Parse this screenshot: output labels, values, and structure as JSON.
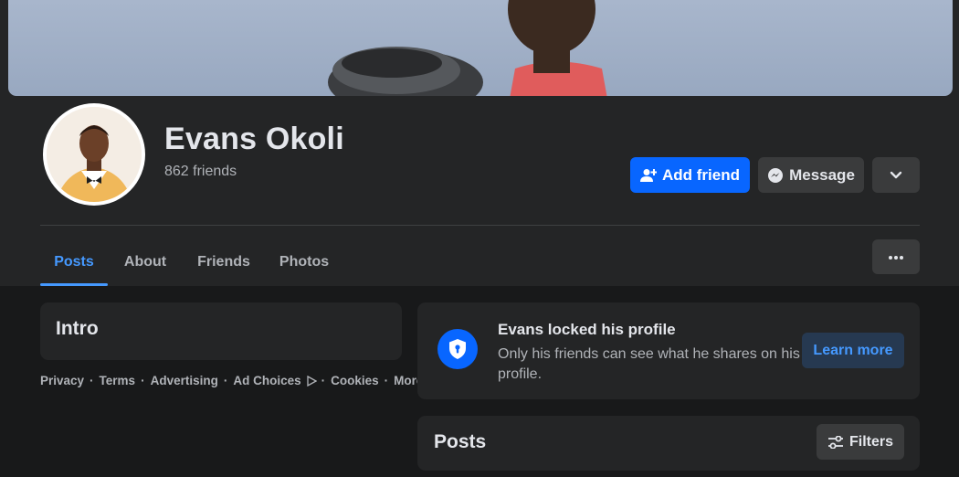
{
  "profile": {
    "name": "Evans Okoli",
    "friends_count": "862 friends"
  },
  "actions": {
    "add_friend": "Add friend",
    "message": "Message"
  },
  "tabs": [
    {
      "label": "Posts",
      "active": true
    },
    {
      "label": "About",
      "active": false
    },
    {
      "label": "Friends",
      "active": false
    },
    {
      "label": "Photos",
      "active": false
    }
  ],
  "intro": {
    "title": "Intro"
  },
  "footer": {
    "links": [
      "Privacy",
      "Terms",
      "Advertising",
      "Ad Choices",
      "Cookies",
      "More"
    ],
    "separator": "·"
  },
  "locked": {
    "title": "Evans locked his profile",
    "description": "Only his friends can see what he shares on his profile.",
    "learn_more": "Learn more"
  },
  "posts": {
    "title": "Posts",
    "filters": "Filters"
  },
  "colors": {
    "accent": "#0866ff",
    "active_tab": "#4599ff",
    "card_bg": "#242526",
    "page_bg": "#18191a"
  },
  "icons": {
    "add_friend": "person-plus-icon",
    "message": "messenger-icon",
    "more": "chevron-down-icon",
    "tab_menu": "ellipsis-icon",
    "locked": "shield-lock-icon",
    "filters": "sliders-icon",
    "ad_choices": "ad-choices-icon"
  }
}
